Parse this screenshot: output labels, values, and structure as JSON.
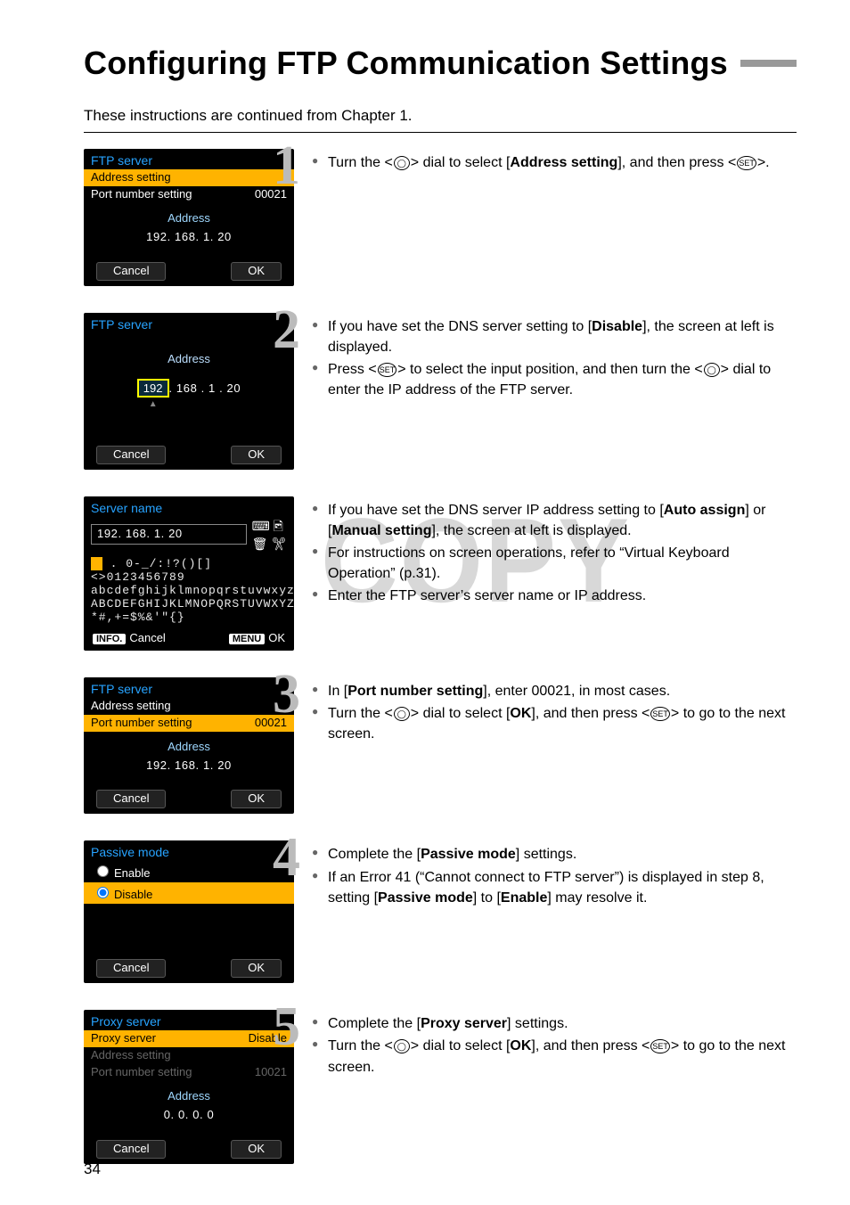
{
  "page_number": "34",
  "title": "Configuring FTP Communication Settings",
  "intro": "These instructions are continued from Chapter 1.",
  "watermark": "COPY",
  "icon": {
    "dial": "◯",
    "set": "SET"
  },
  "steps": {
    "s1": {
      "num": "1",
      "bullets": [
        {
          "pre": "Turn the <",
          "icon": "dial",
          "post": "> dial to select [",
          "bold": "Address setting",
          "post2": "], and then press <",
          "icon2": "set",
          "post3": ">."
        }
      ]
    },
    "s2": {
      "num": "2",
      "bullets": [
        {
          "pre": "If you have set the DNS server setting to [",
          "bold": "Disable",
          "post": "], the screen at left is displayed."
        },
        {
          "pre": "Press <",
          "icon": "set",
          "post": "> to select the input position, and then turn the <",
          "icon2": "dial",
          "post2": "> dial to enter the IP address of the FTP server."
        }
      ]
    },
    "s2b": {
      "bullets": [
        {
          "pre": "If you have set the DNS server IP address setting to [",
          "bold": "Auto assign",
          "post": "] or [",
          "bold2": "Manual setting",
          "post2": "], the screen at left is displayed."
        },
        {
          "text": "For instructions on screen operations, refer to “Virtual Keyboard Operation” (p.31)."
        },
        {
          "text": "Enter the FTP server’s server name or IP address."
        }
      ]
    },
    "s3": {
      "num": "3",
      "bullets": [
        {
          "pre": "In [",
          "bold": "Port number setting",
          "post": "], enter 00021, in most cases."
        },
        {
          "pre": "Turn the <",
          "icon": "dial",
          "post": "> dial to select [",
          "bold": "OK",
          "post2": "], and then press <",
          "icon2": "set",
          "post3": "> to go to the next screen."
        }
      ]
    },
    "s4": {
      "num": "4",
      "bullets": [
        {
          "pre": "Complete the [",
          "bold": "Passive mode",
          "post": "] settings."
        },
        {
          "pre": "If an Error 41 (“Cannot connect to FTP server”) is displayed in step 8, setting [",
          "bold": "Passive mode",
          "post": "] to [",
          "bold2": "Enable",
          "post2": "] may resolve it."
        }
      ]
    },
    "s5": {
      "num": "5",
      "bullets": [
        {
          "pre": "Complete the [",
          "bold": "Proxy server",
          "post": "] settings."
        },
        {
          "pre": "Turn the <",
          "icon": "dial",
          "post": "> dial to select [",
          "bold": "OK",
          "post2": "], and then press <",
          "icon2": "set",
          "post3": "> to go to the next screen."
        }
      ]
    }
  },
  "screens": {
    "a": {
      "title": "FTP server",
      "row1": "Address setting",
      "row2_l": "Port number setting",
      "row2_r": "00021",
      "addr_label": "Address",
      "addr": "192. 168. 1. 20",
      "cancel": "Cancel",
      "ok": "OK"
    },
    "b": {
      "title": "FTP server",
      "addr_label": "Address",
      "seg1": "192",
      "rest": ". 168 .   1 .  20",
      "cancel": "Cancel",
      "ok": "OK"
    },
    "c": {
      "title": "Server name",
      "value": "192. 168. 1. 20",
      "line1": " . 0-_/:!?()[]<>0123456789",
      "line2": "abcdefghijklmnopqrstuvwxyz",
      "line3": "ABCDEFGHIJKLMNOPQRSTUVWXYZ",
      "line4": "*#,+=$%&'\"{} ",
      "info": "INFO.",
      "info_txt": "Cancel",
      "menu": "MENU",
      "menu_txt": "OK"
    },
    "d": {
      "title": "FTP server",
      "row1": "Address setting",
      "row2_l": "Port number setting",
      "row2_r": "00021",
      "addr_label": "Address",
      "addr": "192. 168. 1. 20",
      "cancel": "Cancel",
      "ok": "OK"
    },
    "e": {
      "title": "Passive mode",
      "opt1": "Enable",
      "opt2": "Disable",
      "cancel": "Cancel",
      "ok": "OK"
    },
    "f": {
      "title": "Proxy server",
      "row1_l": "Proxy server",
      "row1_r": "Disable",
      "row2": "Address setting",
      "row3_l": "Port number setting",
      "row3_r": "10021",
      "addr_label": "Address",
      "addr": "0. 0. 0. 0",
      "cancel": "Cancel",
      "ok": "OK"
    }
  }
}
